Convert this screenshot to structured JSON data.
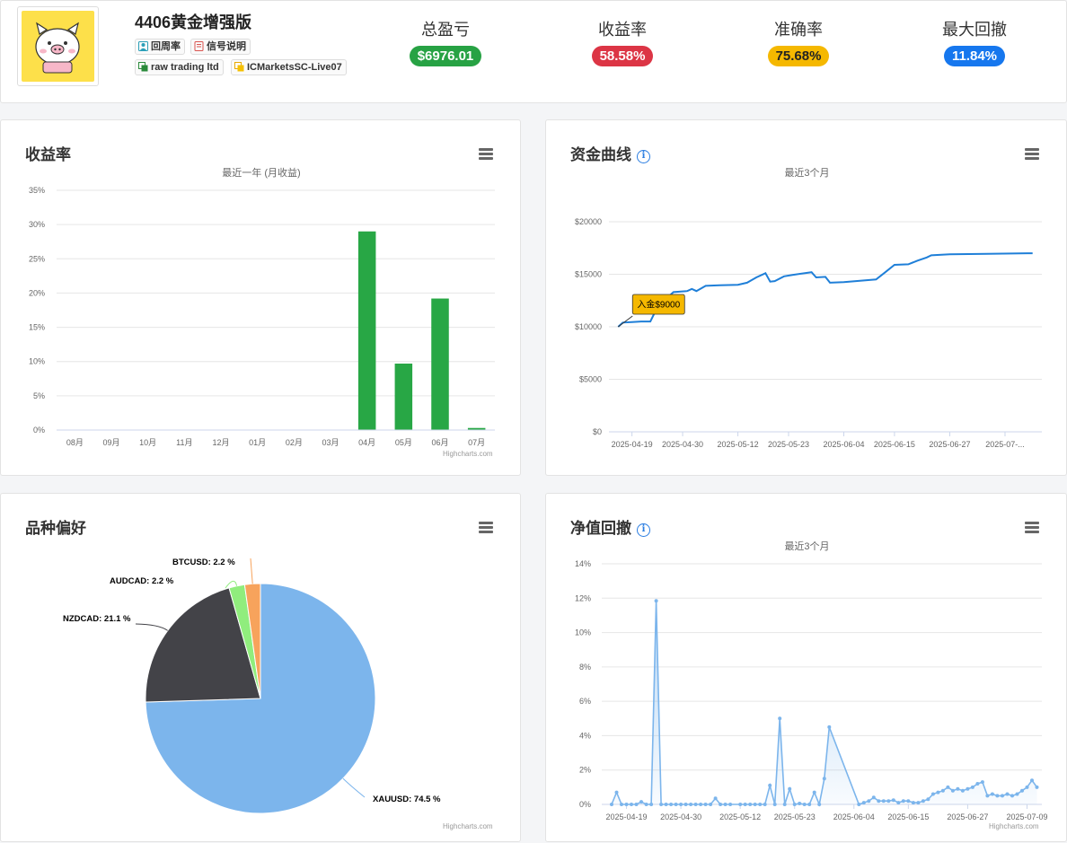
{
  "header": {
    "title": "4406黄金增强版",
    "tags": [
      {
        "label": "回周率",
        "icon": "user-icon"
      },
      {
        "label": "信号说明",
        "icon": "document-icon"
      },
      {
        "label": "raw trading ltd",
        "icon": "broker-icon"
      },
      {
        "label": "ICMarketsSC-Live07",
        "icon": "account-icon"
      }
    ],
    "stats": [
      {
        "label": "总盈亏",
        "value": "$6976.01",
        "color": "#27a244"
      },
      {
        "label": "收益率",
        "value": "58.58%",
        "color": "#dc3545"
      },
      {
        "label": "准确率",
        "value": "75.68%",
        "color": "#f5b800"
      },
      {
        "label": "最大回撤",
        "value": "11.84%",
        "color": "#1677ee"
      }
    ]
  },
  "credits": "Highcharts.com",
  "chart_data": [
    {
      "id": "monthly-return",
      "type": "bar",
      "title": "收益率",
      "subtitle": "最近一年 (月收益)",
      "categories": [
        "08月",
        "09月",
        "10月",
        "11月",
        "12月",
        "01月",
        "02月",
        "03月",
        "04月",
        "05月",
        "06月",
        "07月"
      ],
      "values": [
        0,
        0,
        0,
        0,
        0,
        0,
        0,
        0,
        29.0,
        9.7,
        19.2,
        0.3
      ],
      "y_ticks": [
        "0%",
        "5%",
        "10%",
        "15%",
        "20%",
        "25%",
        "30%",
        "35%"
      ],
      "ylim": [
        0,
        35
      ],
      "color": "#28a745"
    },
    {
      "id": "equity-curve",
      "type": "line",
      "title": "资金曲线",
      "subtitle": "最近3个月",
      "x_ticks": [
        "2025-04-19",
        "2025-04-30",
        "2025-05-12",
        "2025-05-23",
        "2025-06-04",
        "2025-06-15",
        "2025-06-27",
        "2025-07-..."
      ],
      "y_ticks": [
        "$0",
        "$5000",
        "$10000",
        "$15000",
        "$20000"
      ],
      "ylim": [
        0,
        20000
      ],
      "annotation": "入金$9000",
      "color": "#1f7fd8",
      "points": [
        [
          "2025-04-16",
          10000
        ],
        [
          "2025-04-17",
          10400
        ],
        [
          "2025-04-19",
          10450
        ],
        [
          "2025-04-21",
          10500
        ],
        [
          "2025-04-23",
          10500
        ],
        [
          "2025-04-24",
          11400
        ],
        [
          "2025-04-26",
          12500
        ],
        [
          "2025-04-28",
          13300
        ],
        [
          "2025-05-01",
          13400
        ],
        [
          "2025-05-02",
          13600
        ],
        [
          "2025-05-03",
          13400
        ],
        [
          "2025-05-05",
          13900
        ],
        [
          "2025-05-08",
          13950
        ],
        [
          "2025-05-12",
          14000
        ],
        [
          "2025-05-14",
          14200
        ],
        [
          "2025-05-16",
          14700
        ],
        [
          "2025-05-18",
          15100
        ],
        [
          "2025-05-19",
          14300
        ],
        [
          "2025-05-20",
          14350
        ],
        [
          "2025-05-22",
          14800
        ],
        [
          "2025-05-24",
          14950
        ],
        [
          "2025-05-28",
          15200
        ],
        [
          "2025-05-29",
          14700
        ],
        [
          "2025-05-31",
          14750
        ],
        [
          "2025-06-01",
          14200
        ],
        [
          "2025-06-04",
          14250
        ],
        [
          "2025-06-11",
          14500
        ],
        [
          "2025-06-13",
          15200
        ],
        [
          "2025-06-15",
          15900
        ],
        [
          "2025-06-18",
          15950
        ],
        [
          "2025-06-20",
          16300
        ],
        [
          "2025-06-22",
          16600
        ],
        [
          "2025-06-23",
          16800
        ],
        [
          "2025-06-27",
          16900
        ],
        [
          "2025-07-05",
          16950
        ],
        [
          "2025-07-15",
          17000
        ]
      ]
    },
    {
      "id": "symbol-preference",
      "type": "pie",
      "title": "品种偏好",
      "slices": [
        {
          "name": "XAUUSD",
          "value": 74.5,
          "label": "XAUUSD: 74.5 %",
          "color": "#7cb5ec"
        },
        {
          "name": "NZDCAD",
          "value": 21.1,
          "label": "NZDCAD: 21.1 %",
          "color": "#434348"
        },
        {
          "name": "AUDCAD",
          "value": 2.2,
          "label": "AUDCAD: 2.2 %",
          "color": "#90ed7d"
        },
        {
          "name": "BTCUSD",
          "value": 2.2,
          "label": "BTCUSD: 2.2 %",
          "color": "#f7a35c"
        }
      ]
    },
    {
      "id": "drawdown",
      "type": "area",
      "title": "净值回撤",
      "subtitle": "最近3个月",
      "x_ticks": [
        "2025-04-19",
        "2025-04-30",
        "2025-05-12",
        "2025-05-23",
        "2025-06-04",
        "2025-06-15",
        "2025-06-27",
        "2025-07-09"
      ],
      "y_ticks": [
        "0%",
        "2%",
        "4%",
        "6%",
        "8%",
        "10%",
        "12%",
        "14%"
      ],
      "ylim": [
        0,
        14
      ],
      "color": "#7cb5ec",
      "points": [
        [
          "2025-04-16",
          0
        ],
        [
          "2025-04-17",
          0.7
        ],
        [
          "2025-04-18",
          0
        ],
        [
          "2025-04-19",
          0
        ],
        [
          "2025-04-20",
          0
        ],
        [
          "2025-04-21",
          0
        ],
        [
          "2025-04-22",
          0.15
        ],
        [
          "2025-04-23",
          0
        ],
        [
          "2025-04-24",
          0
        ],
        [
          "2025-04-25",
          11.84
        ],
        [
          "2025-04-26",
          0
        ],
        [
          "2025-04-27",
          0
        ],
        [
          "2025-04-28",
          0
        ],
        [
          "2025-04-29",
          0
        ],
        [
          "2025-04-30",
          0
        ],
        [
          "2025-05-01",
          0
        ],
        [
          "2025-05-02",
          0
        ],
        [
          "2025-05-03",
          0
        ],
        [
          "2025-05-04",
          0
        ],
        [
          "2025-05-05",
          0
        ],
        [
          "2025-05-06",
          0
        ],
        [
          "2025-05-07",
          0.35
        ],
        [
          "2025-05-08",
          0
        ],
        [
          "2025-05-09",
          0
        ],
        [
          "2025-05-10",
          0
        ],
        [
          "2025-05-12",
          0
        ],
        [
          "2025-05-13",
          0
        ],
        [
          "2025-05-14",
          0
        ],
        [
          "2025-05-15",
          0
        ],
        [
          "2025-05-16",
          0
        ],
        [
          "2025-05-17",
          0
        ],
        [
          "2025-05-18",
          1.1
        ],
        [
          "2025-05-19",
          0
        ],
        [
          "2025-05-20",
          5.0
        ],
        [
          "2025-05-21",
          0
        ],
        [
          "2025-05-22",
          0.9
        ],
        [
          "2025-05-23",
          0
        ],
        [
          "2025-05-24",
          0.05
        ],
        [
          "2025-05-25",
          0
        ],
        [
          "2025-05-26",
          0
        ],
        [
          "2025-05-27",
          0.7
        ],
        [
          "2025-05-28",
          0
        ],
        [
          "2025-05-29",
          1.5
        ],
        [
          "2025-05-30",
          4.5
        ],
        [
          "2025-06-05",
          0
        ],
        [
          "2025-06-06",
          0.1
        ],
        [
          "2025-06-07",
          0.2
        ],
        [
          "2025-06-08",
          0.4
        ],
        [
          "2025-06-09",
          0.2
        ],
        [
          "2025-06-10",
          0.2
        ],
        [
          "2025-06-11",
          0.2
        ],
        [
          "2025-06-12",
          0.25
        ],
        [
          "2025-06-13",
          0.1
        ],
        [
          "2025-06-14",
          0.2
        ],
        [
          "2025-06-15",
          0.2
        ],
        [
          "2025-06-16",
          0.1
        ],
        [
          "2025-06-17",
          0.1
        ],
        [
          "2025-06-18",
          0.2
        ],
        [
          "2025-06-19",
          0.3
        ],
        [
          "2025-06-20",
          0.6
        ],
        [
          "2025-06-21",
          0.7
        ],
        [
          "2025-06-22",
          0.8
        ],
        [
          "2025-06-23",
          1.0
        ],
        [
          "2025-06-24",
          0.8
        ],
        [
          "2025-06-25",
          0.9
        ],
        [
          "2025-06-26",
          0.8
        ],
        [
          "2025-06-27",
          0.9
        ],
        [
          "2025-06-28",
          1.0
        ],
        [
          "2025-06-29",
          1.2
        ],
        [
          "2025-06-30",
          1.3
        ],
        [
          "2025-07-01",
          0.5
        ],
        [
          "2025-07-02",
          0.6
        ],
        [
          "2025-07-03",
          0.5
        ],
        [
          "2025-07-04",
          0.5
        ],
        [
          "2025-07-05",
          0.6
        ],
        [
          "2025-07-06",
          0.5
        ],
        [
          "2025-07-07",
          0.6
        ],
        [
          "2025-07-08",
          0.8
        ],
        [
          "2025-07-09",
          1.0
        ],
        [
          "2025-07-10",
          1.4
        ],
        [
          "2025-07-11",
          1.0
        ]
      ]
    }
  ]
}
